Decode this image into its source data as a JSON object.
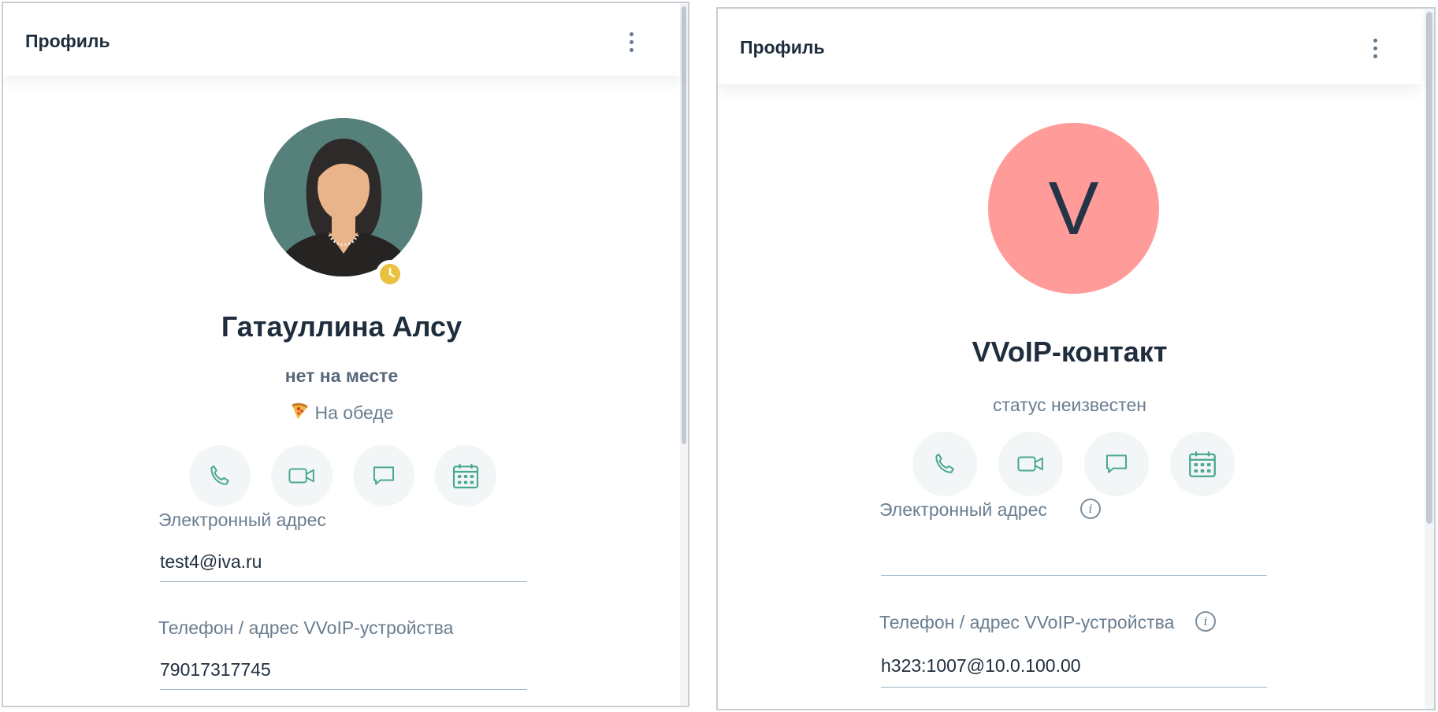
{
  "colors": {
    "accent": "#48a88e",
    "avatar_left_bg": "#56807a",
    "avatar_right_bg": "#ff9c9a",
    "away_badge": "#eac13e"
  },
  "profiles": [
    {
      "header": {
        "title": "Профиль",
        "menu_icon": "kebab-menu-icon"
      },
      "avatar": {
        "type": "photo",
        "status_badge_icon": "clock-icon"
      },
      "name": "Гатауллина Алсу",
      "presence": "нет на месте",
      "custom_status": {
        "emoji_icon": "pizza-icon",
        "text": "На обеде"
      },
      "actions": [
        {
          "icon": "phone-icon"
        },
        {
          "icon": "video-camera-icon"
        },
        {
          "icon": "chat-icon"
        },
        {
          "icon": "calendar-icon"
        }
      ],
      "fields": [
        {
          "label": "Электронный адрес",
          "value": "test4@iva.ru"
        },
        {
          "label": "Телефон / адрес VVoIP-устройства",
          "value": "79017317745"
        }
      ]
    },
    {
      "header": {
        "title": "Профиль",
        "menu_icon": "kebab-menu-icon"
      },
      "avatar": {
        "type": "initial",
        "letter": "V"
      },
      "name": "VVoIP-контакт",
      "presence": "статус неизвестен",
      "actions": [
        {
          "icon": "phone-icon"
        },
        {
          "icon": "video-camera-icon"
        },
        {
          "icon": "chat-icon"
        },
        {
          "icon": "calendar-icon"
        }
      ],
      "fields": [
        {
          "label": "Электронный адрес",
          "value": "",
          "info_icon": "info-icon",
          "info_glyph": "i"
        },
        {
          "label": "Телефон / адрес VVoIP-устройства",
          "value": "h323:1007@10.0.100.00",
          "info_icon": "info-icon",
          "info_glyph": "i"
        }
      ]
    }
  ]
}
